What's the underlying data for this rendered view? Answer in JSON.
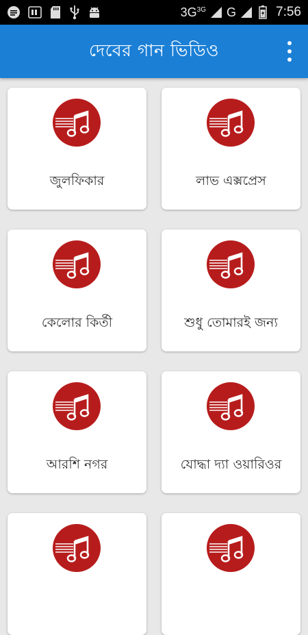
{
  "status_bar": {
    "icons": [
      "message-icon",
      "sim-icon",
      "sd-card-icon",
      "usb-icon",
      "android-icon"
    ],
    "network": "3G",
    "network_sup": "3G",
    "network2": "G",
    "time": "7:56"
  },
  "app_bar": {
    "title": "দেবের গান ভিডিও"
  },
  "items": [
    {
      "label": "জুলফিকার"
    },
    {
      "label": "লাভ এক্সপ্রেস"
    },
    {
      "label": "কেলোর কির্তী"
    },
    {
      "label": "শুধু তোমারই জন্য"
    },
    {
      "label": "আরশি নগর"
    },
    {
      "label": "যোদ্ধা দ্যা ওয়ারিওর"
    },
    {
      "label": ""
    },
    {
      "label": ""
    }
  ],
  "colors": {
    "app_bar": "#1b7fd6",
    "logo_red": "#b71c1c",
    "background": "#e8e8e8"
  }
}
